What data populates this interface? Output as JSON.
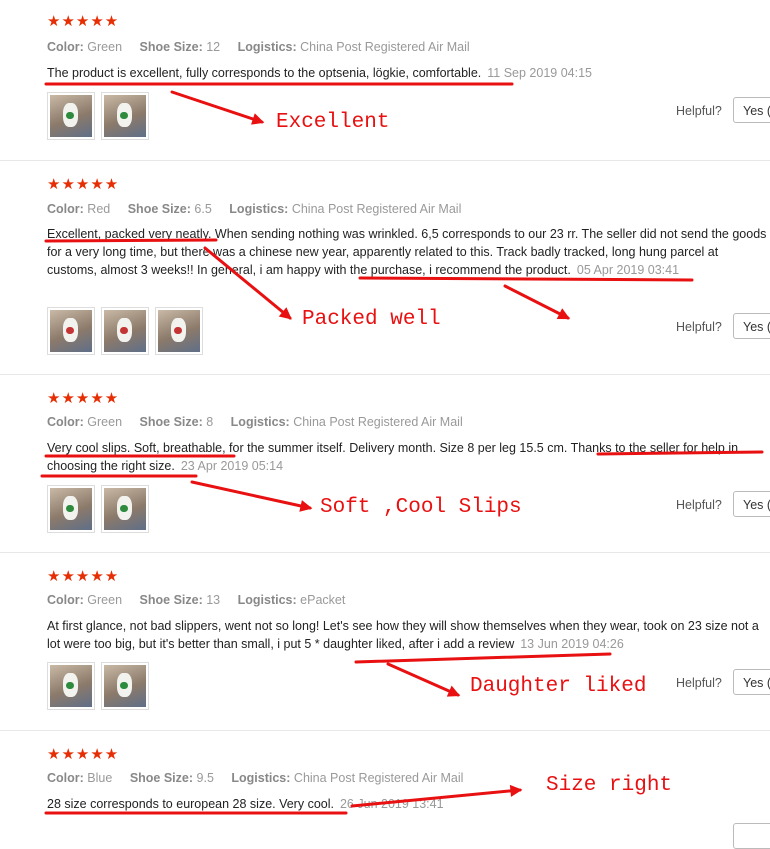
{
  "colors": {
    "star": "#e62e04",
    "annotation": "#e81010",
    "muted": "#999999"
  },
  "labels": {
    "color": "Color:",
    "shoe_size": "Shoe Size:",
    "logistics": "Logistics:",
    "helpful": "Helpful?",
    "yes": "Yes ("
  },
  "reviews": [
    {
      "stars": "★★★★★",
      "color": "Green",
      "shoe_size": "12",
      "logistics": "China Post Registered Air Mail",
      "text": "The product is excellent, fully corresponds to the optsenia, lögkie, comfortable.",
      "date": "11 Sep 2019 04:15",
      "photos": 2,
      "annotation": "Excellent"
    },
    {
      "stars": "★★★★★",
      "color": "Red",
      "shoe_size": "6.5",
      "logistics": "China Post Registered Air Mail",
      "text": "Excellent, packed very neatly. When sending nothing was wrinkled. 6,5 corresponds to our 23 rr. The seller did not send the goods for a very long time, but there was a chinese new year, apparently related to this. Track badly tracked, long hung parcel at customs, almost 3 weeks!! In general, i am happy with the purchase, i recommend the product.",
      "date": "05 Apr 2019 03:41",
      "photos": 3,
      "annotation": "Packed well"
    },
    {
      "stars": "★★★★★",
      "color": "Green",
      "shoe_size": "8",
      "logistics": "China Post Registered Air Mail",
      "text": "Very cool slips. Soft, breathable, for the summer itself. Delivery month. Size 8 per leg 15.5 cm. Thanks to the seller for help in choosing the right size.",
      "date": "23 Apr 2019 05:14",
      "photos": 2,
      "annotation": "Soft ,Cool Slips"
    },
    {
      "stars": "★★★★★",
      "color": "Green",
      "shoe_size": "13",
      "logistics": "ePacket",
      "text": "At first glance, not bad slippers, went not so long! Let's see how they will show themselves when they wear, took on 23 size not a lot were too big, but it's better than small, i put 5 * daughter liked, after i add a review",
      "date": "13 Jun 2019 04:26",
      "photos": 2,
      "annotation": "Daughter liked"
    },
    {
      "stars": "★★★★★",
      "color": "Blue",
      "shoe_size": "9.5",
      "logistics": "China Post Registered Air Mail",
      "text": "28 size corresponds to european 28 size. Very cool.",
      "date": "26 Jun 2019 13:41",
      "photos": 0,
      "annotation": "Size right"
    }
  ]
}
